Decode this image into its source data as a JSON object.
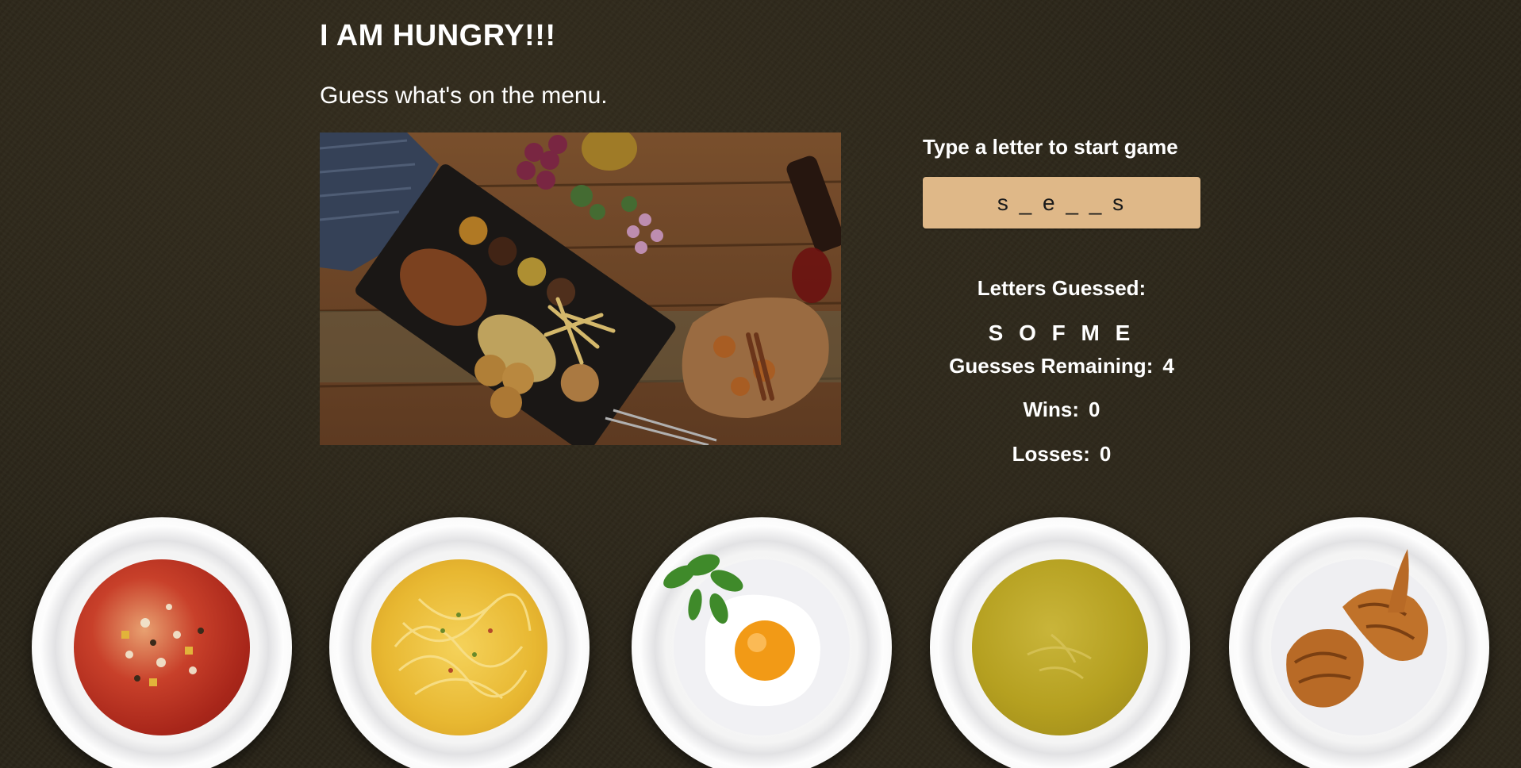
{
  "header": {
    "title": "I AM HUNGRY!!!",
    "subtitle": "Guess what's on the menu."
  },
  "game": {
    "prompt": "Type a letter to start game",
    "current_word": "s _ e _ _ s",
    "letters_guessed_label": "Letters Guessed:",
    "letters_guessed": "S O F M E",
    "guesses_remaining_label": "Guesses Remaining:",
    "guesses_remaining": "4",
    "wins_label": "Wins:",
    "wins": "0",
    "losses_label": "Losses:",
    "losses": "0"
  },
  "colors": {
    "background": "#2a2519",
    "word_box": "#dfb888",
    "text": "#ffffff"
  },
  "plates": [
    {
      "food": "minestrone-soup"
    },
    {
      "food": "spaghetti"
    },
    {
      "food": "fried-egg"
    },
    {
      "food": "yellow-soup"
    },
    {
      "food": "croissants"
    }
  ]
}
